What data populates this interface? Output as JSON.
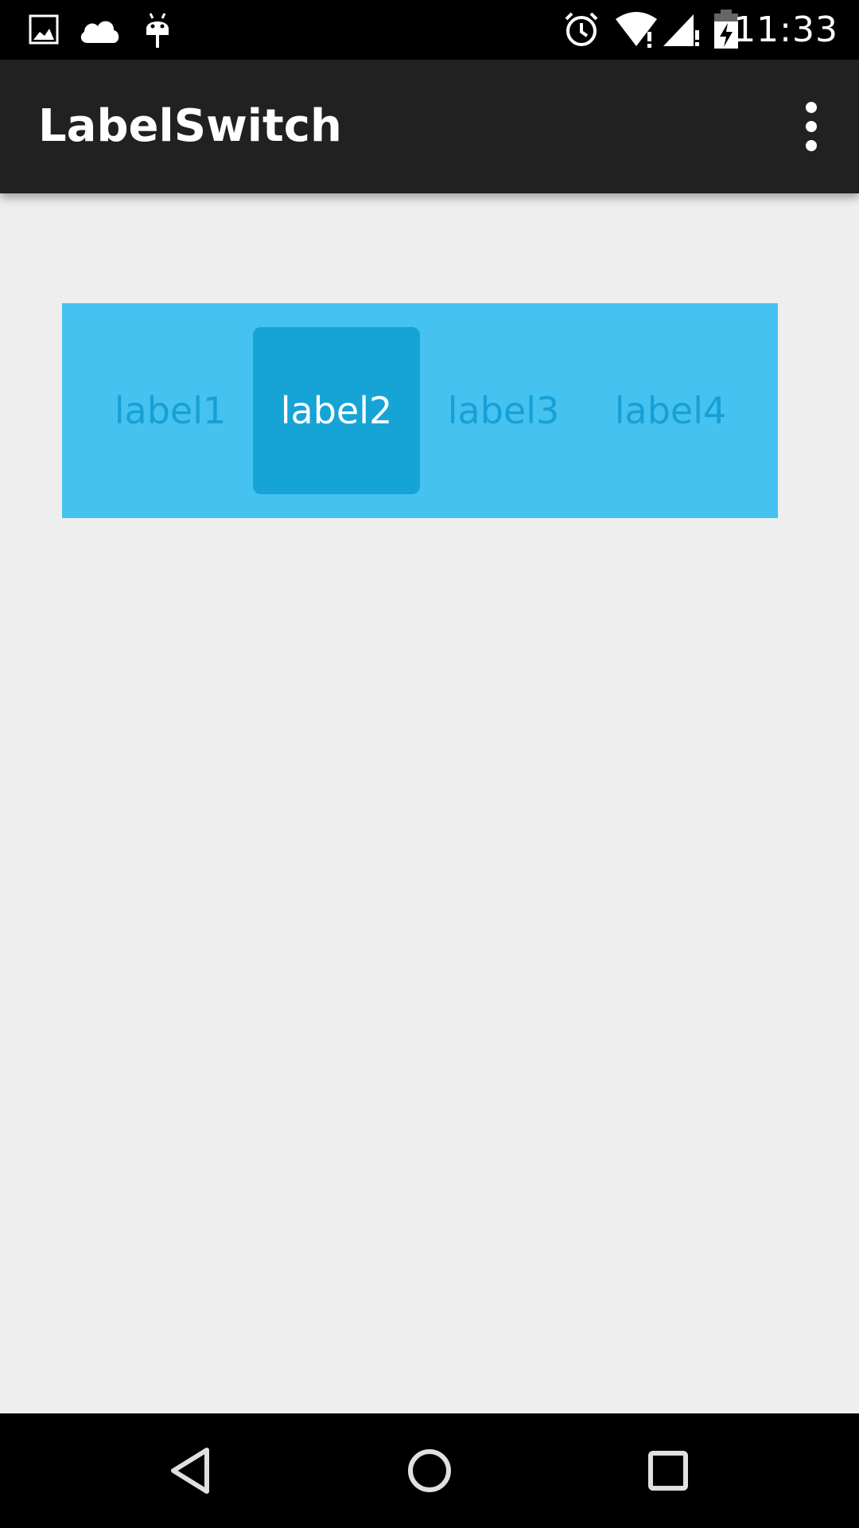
{
  "status_bar": {
    "time": "11:33",
    "left_icons": [
      "image-icon",
      "cloud-icon",
      "android-debug-icon"
    ],
    "right_icons": [
      "alarm-icon",
      "wifi-icon",
      "signal-icon",
      "battery-charging-icon"
    ]
  },
  "action_bar": {
    "title": "LabelSwitch",
    "overflow_icon": "more-vert-icon"
  },
  "label_switch": {
    "background_color": "#45c2ef",
    "selected_color": "#16a3d6",
    "label_color": "#17a0d6",
    "selected_index": 1,
    "labels": [
      "label1",
      "label2",
      "label3",
      "label4"
    ]
  },
  "nav_bar": {
    "icons": [
      "back-icon",
      "home-icon",
      "recents-icon"
    ]
  }
}
